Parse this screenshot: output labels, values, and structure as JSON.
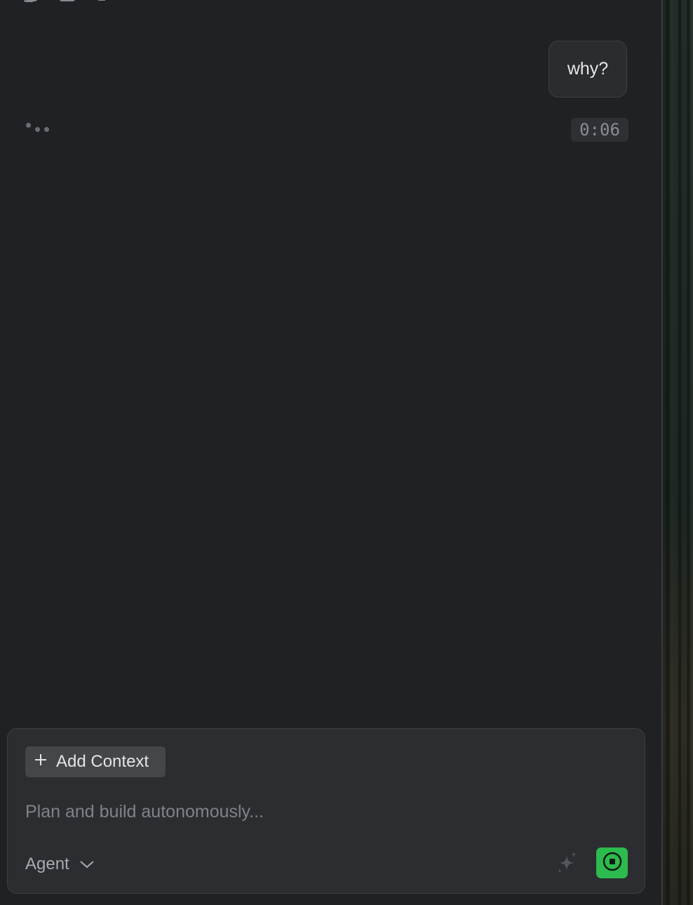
{
  "chat": {
    "user_message": "why?",
    "elapsed_time": "0:06"
  },
  "composer": {
    "add_context_label": "Add Context",
    "placeholder": "Plan and build autonomously...",
    "mode_label": "Agent"
  },
  "icons": {
    "toolbar": [
      "copy-icon",
      "duplicate-icon",
      "thumbs-down-icon"
    ],
    "composer": [
      "plus-icon",
      "chevron-down-icon",
      "sparkle-icon",
      "stop-icon"
    ]
  },
  "colors": {
    "background": "#202124",
    "composer_background": "#2c2d30",
    "stop_button": "#2dba4e"
  }
}
